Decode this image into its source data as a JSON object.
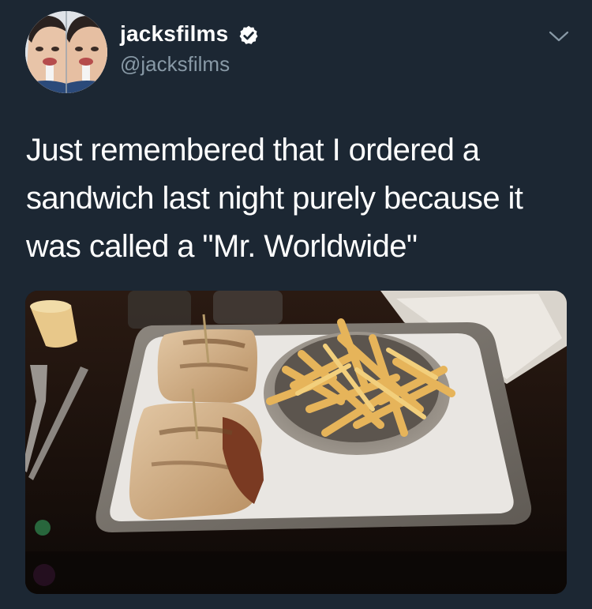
{
  "tweet": {
    "author": {
      "display_name": "jacksfilms",
      "handle": "@jacksfilms",
      "verified": true
    },
    "text_lines": [
      "Just remembered that I ordered a",
      "sandwich last night purely because it",
      "was called a \"Mr. Worldwide\""
    ],
    "photo": {
      "subject": "sandwich-and-fries-photo"
    }
  },
  "icons": {
    "verified": "verified-badge-icon",
    "menu": "chevron-down-icon"
  },
  "colors": {
    "background": "#1c2733",
    "text": "#ffffff",
    "handle": "#8899a6",
    "chevron": "#8899a6"
  }
}
